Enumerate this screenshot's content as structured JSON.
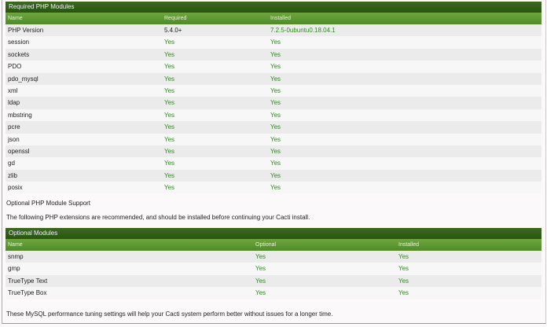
{
  "required": {
    "title": "Required PHP Modules",
    "headers": [
      "Name",
      "Required",
      "Installed"
    ],
    "rows": [
      [
        "PHP Version",
        "5.4.0+",
        "7.2.5-0ubuntu0.18.04.1"
      ],
      [
        "session",
        "Yes",
        "Yes"
      ],
      [
        "sockets",
        "Yes",
        "Yes"
      ],
      [
        "PDO",
        "Yes",
        "Yes"
      ],
      [
        "pdo_mysql",
        "Yes",
        "Yes"
      ],
      [
        "xml",
        "Yes",
        "Yes"
      ],
      [
        "ldap",
        "Yes",
        "Yes"
      ],
      [
        "mbstring",
        "Yes",
        "Yes"
      ],
      [
        "pcre",
        "Yes",
        "Yes"
      ],
      [
        "json",
        "Yes",
        "Yes"
      ],
      [
        "openssl",
        "Yes",
        "Yes"
      ],
      [
        "gd",
        "Yes",
        "Yes"
      ],
      [
        "zlib",
        "Yes",
        "Yes"
      ],
      [
        "posix",
        "Yes",
        "Yes"
      ]
    ]
  },
  "optional_heading": "Optional PHP Module Support",
  "optional_intro": "The following PHP extensions are recommended, and should be installed before continuing your Cacti install.",
  "optional": {
    "title": "Optional Modules",
    "headers": [
      "Name",
      "Optional",
      "Installed"
    ],
    "rows": [
      [
        "snmp",
        "Yes",
        "Yes"
      ],
      [
        "gmp",
        "Yes",
        "Yes"
      ],
      [
        "TrueType Text",
        "Yes",
        "Yes"
      ],
      [
        "TrueType Box",
        "Yes",
        "Yes"
      ]
    ]
  },
  "mysql_intro": "These MySQL performance tuning settings will help your Cacti system perform better without issues for a longer time."
}
